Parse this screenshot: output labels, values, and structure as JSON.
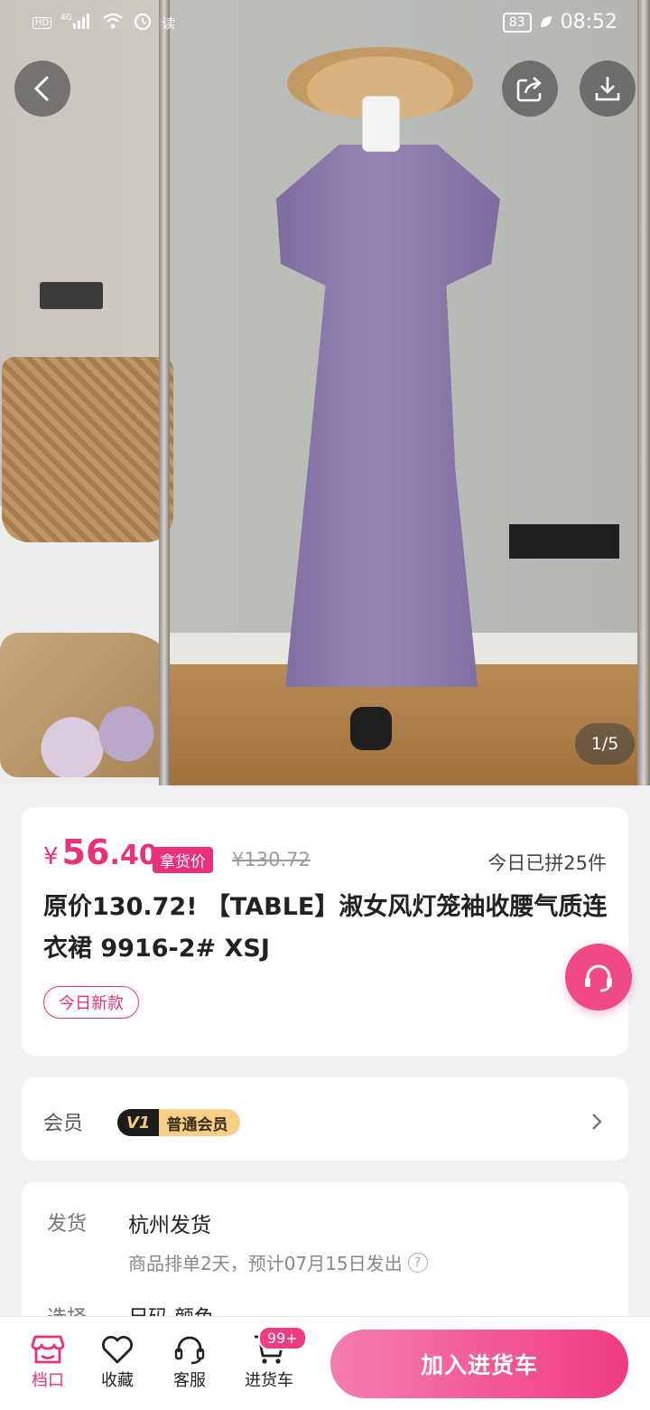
{
  "status_bar": {
    "left_icons": [
      "hd-icon",
      "4g-signal-icon",
      "wifi-icon",
      "alarm-icon"
    ],
    "read_label": "读",
    "battery": "83",
    "time": "08:52"
  },
  "gallery": {
    "counter": "1/5"
  },
  "product": {
    "currency": "¥",
    "price_int": "56",
    "price_dec": ".40",
    "price_tag": "拿货价",
    "original_price": "¥130.72",
    "today_sold": "今日已拼25件",
    "title": "原价130.72! 【TABLE】淑女风灯笼袖收腰气质连衣裙 9916-2# XSJ",
    "badge": "今日新款"
  },
  "member": {
    "label": "会员",
    "level": "V1",
    "level_name": "普通会员"
  },
  "shipping": {
    "label": "发货",
    "origin": "杭州发货",
    "note": "商品排单2天，预计07月15日发出",
    "select_label": "选择",
    "select_value": "尺码  颜色"
  },
  "bottom_bar": {
    "tabs": [
      {
        "label": "档口",
        "icon": "shop-icon",
        "active": true
      },
      {
        "label": "收藏",
        "icon": "heart-icon"
      },
      {
        "label": "客服",
        "icon": "headset-icon"
      },
      {
        "label": "进货车",
        "icon": "cart-icon"
      }
    ],
    "cart_badge": "99+",
    "add_to_cart": "加入进货车"
  },
  "colors": {
    "accent": "#e8317a",
    "button_gradient_start": "#f47db0",
    "button_gradient_end": "#f03b82"
  }
}
